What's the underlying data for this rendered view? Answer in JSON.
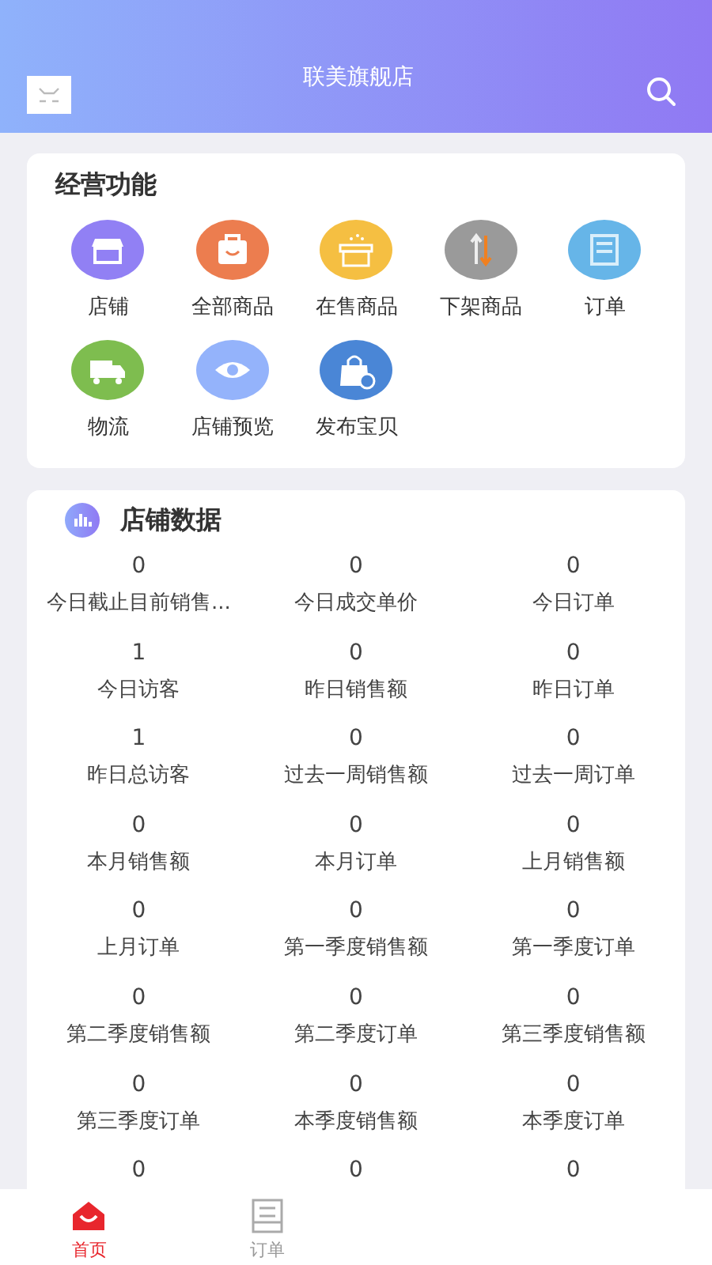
{
  "header": {
    "title": "联美旗舰店"
  },
  "functions": {
    "title": "经营功能",
    "items": [
      {
        "label": "店铺"
      },
      {
        "label": "全部商品"
      },
      {
        "label": "在售商品"
      },
      {
        "label": "下架商品"
      },
      {
        "label": "订单"
      },
      {
        "label": "物流"
      },
      {
        "label": "店铺预览"
      },
      {
        "label": "发布宝贝"
      }
    ]
  },
  "store_data": {
    "title": "店铺数据",
    "stats": [
      {
        "value": "0",
        "label": "今日截止目前销售..."
      },
      {
        "value": "0",
        "label": "今日成交单价"
      },
      {
        "value": "0",
        "label": "今日订单"
      },
      {
        "value": "1",
        "label": "今日访客"
      },
      {
        "value": "0",
        "label": "昨日销售额"
      },
      {
        "value": "0",
        "label": "昨日订单"
      },
      {
        "value": "1",
        "label": "昨日总访客"
      },
      {
        "value": "0",
        "label": "过去一周销售额"
      },
      {
        "value": "0",
        "label": "过去一周订单"
      },
      {
        "value": "0",
        "label": "本月销售额"
      },
      {
        "value": "0",
        "label": "本月订单"
      },
      {
        "value": "0",
        "label": "上月销售额"
      },
      {
        "value": "0",
        "label": "上月订单"
      },
      {
        "value": "0",
        "label": "第一季度销售额"
      },
      {
        "value": "0",
        "label": "第一季度订单"
      },
      {
        "value": "0",
        "label": "第二季度销售额"
      },
      {
        "value": "0",
        "label": "第二季度订单"
      },
      {
        "value": "0",
        "label": "第三季度销售额"
      },
      {
        "value": "0",
        "label": "第三季度订单"
      },
      {
        "value": "0",
        "label": "本季度销售额"
      },
      {
        "value": "0",
        "label": "本季度订单"
      },
      {
        "value": "0"
      },
      {
        "value": "0"
      },
      {
        "value": "0"
      }
    ]
  },
  "tab_bar": [
    {
      "label": "首页",
      "selected": true
    },
    {
      "label": "订单",
      "selected": false
    }
  ]
}
